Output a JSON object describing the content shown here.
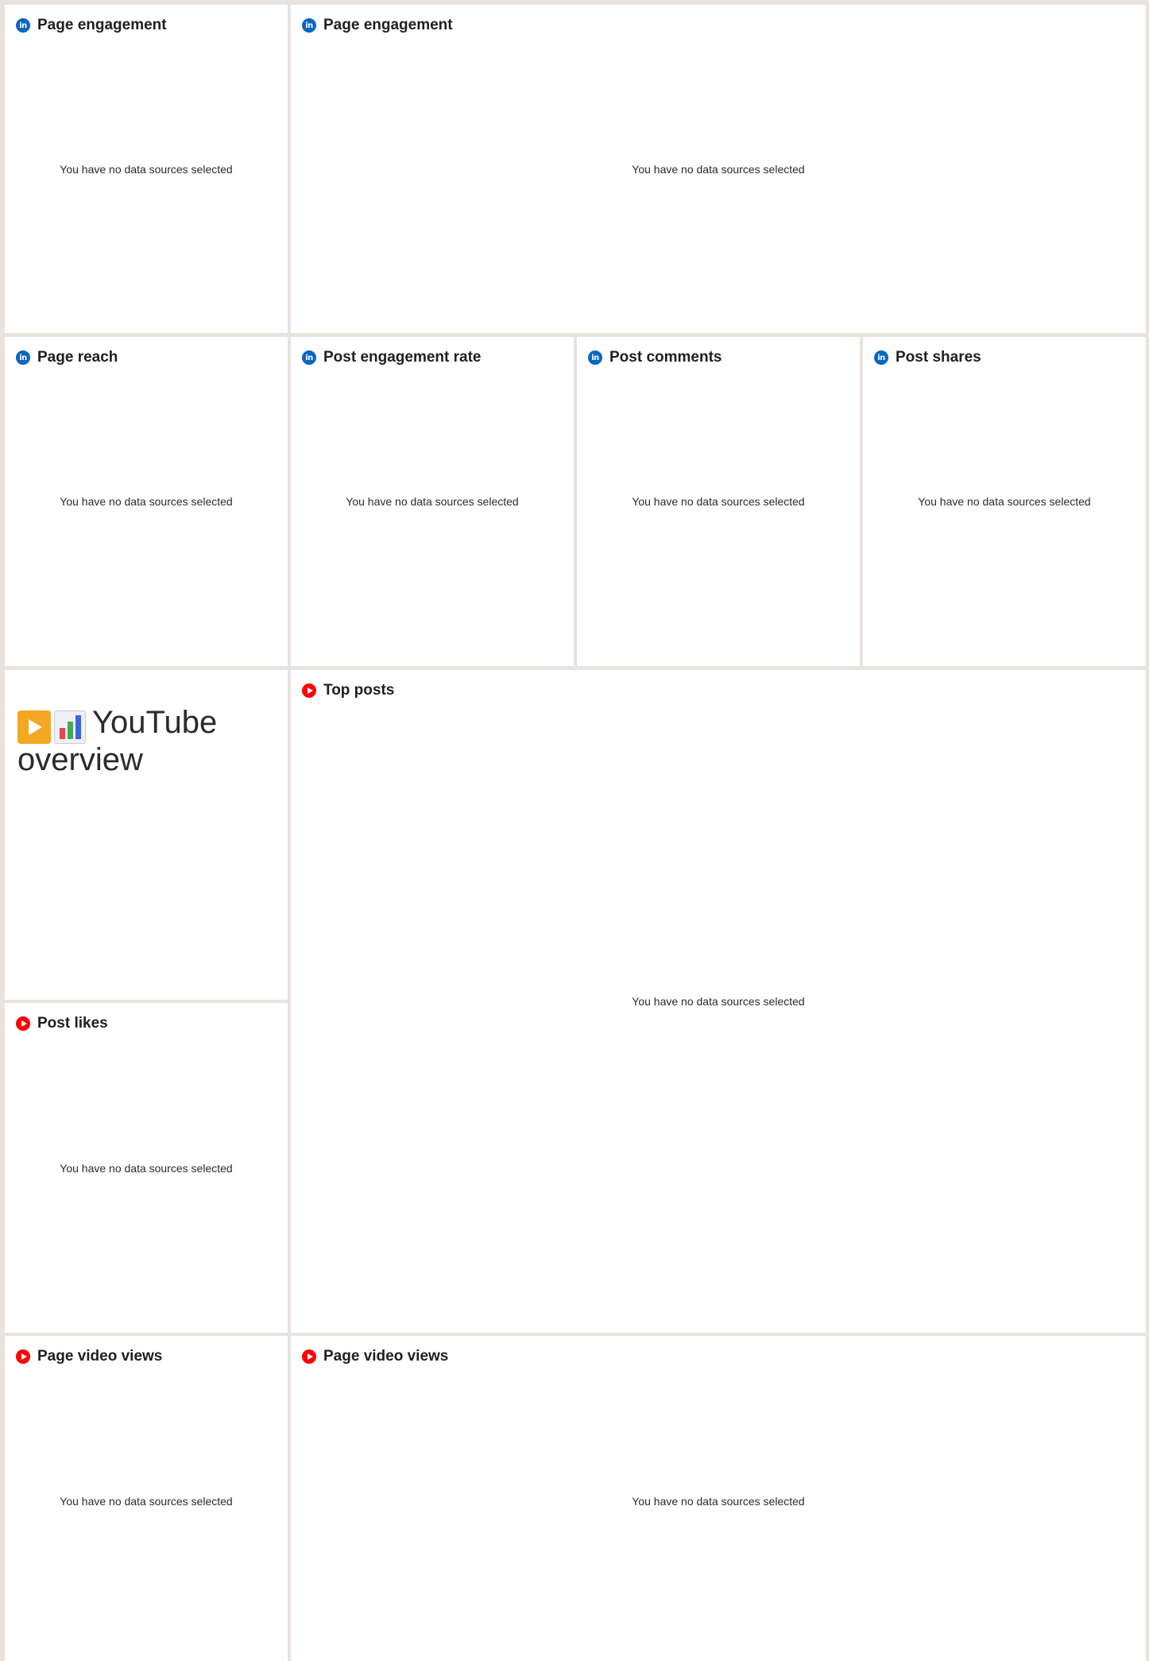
{
  "empty_state_text": "You have no data sources selected",
  "section_header": {
    "icons": [
      "play-button-icon",
      "bar-chart-icon"
    ],
    "text": "YouTube overview"
  },
  "widgets": [
    {
      "title": "Page engagement",
      "platform": "linkedin"
    },
    {
      "title": "Page engagement",
      "platform": "linkedin"
    },
    {
      "title": "Page reach",
      "platform": "linkedin"
    },
    {
      "title": "Post engagement rate",
      "platform": "linkedin"
    },
    {
      "title": "Post comments",
      "platform": "linkedin"
    },
    {
      "title": "Post shares",
      "platform": "linkedin"
    },
    {
      "title": "Top posts",
      "platform": "youtube"
    },
    {
      "title": "Post likes",
      "platform": "youtube"
    },
    {
      "title": "Page video views",
      "platform": "youtube"
    },
    {
      "title": "Page video views",
      "platform": "youtube"
    }
  ],
  "colors": {
    "linkedin": "#0a66c2",
    "youtube": "#ff0000",
    "background": "#e8e3df",
    "card": "#ffffff"
  },
  "linkedin_icon_glyph": "in"
}
